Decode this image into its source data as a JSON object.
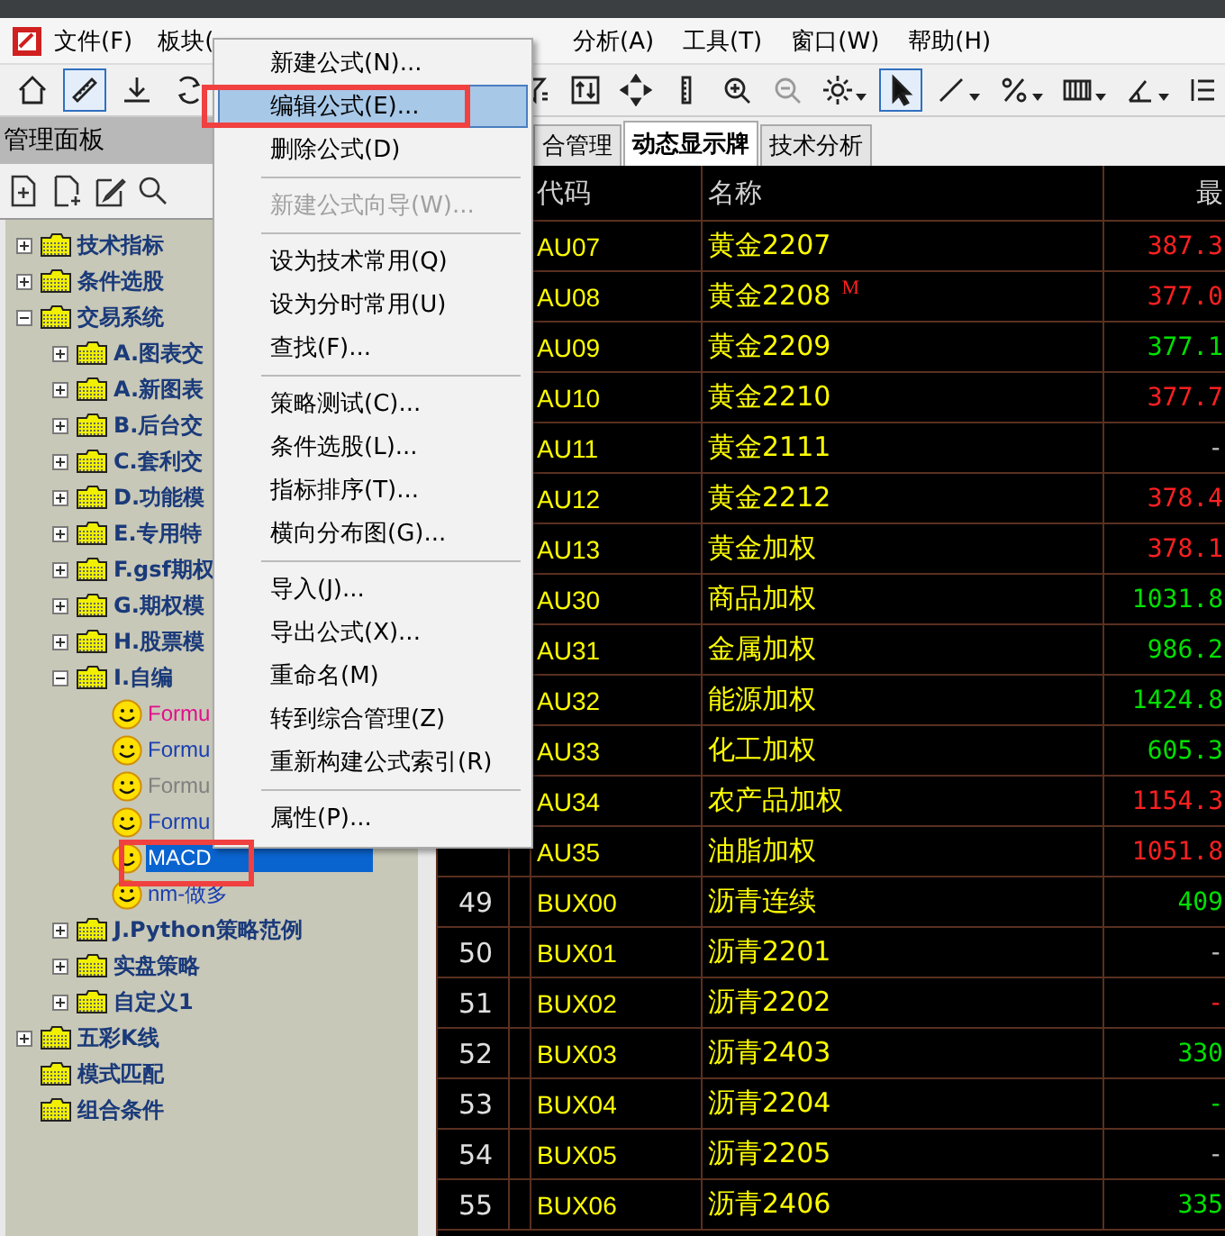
{
  "menubar": {
    "left": [
      "文件(F)",
      "板块("
    ],
    "right": [
      "分析(A)",
      "工具(T)",
      "窗口(W)",
      "帮助(H)"
    ]
  },
  "toolbar": {
    "left": [
      {
        "selected": false
      },
      {
        "selected": true
      },
      {
        "selected": false
      },
      {
        "selected": false
      }
    ],
    "right": [
      {
        "selected": false
      },
      {
        "selected": false
      },
      {
        "selected": false
      },
      {
        "selected": false
      },
      {
        "selected": false
      },
      {
        "selected": false,
        "disabled": true
      },
      {
        "selected": false
      },
      {
        "selected": true
      },
      {
        "selected": false
      },
      {
        "selected": false
      },
      {
        "selected": false
      },
      {
        "selected": false
      },
      {
        "selected": false
      }
    ]
  },
  "panel": {
    "title": "管理面板"
  },
  "tree": [
    {
      "label": "技术指标",
      "kind": "folder",
      "expanded": false
    },
    {
      "label": "条件选股",
      "kind": "folder",
      "expanded": false
    },
    {
      "label": "交易系统",
      "kind": "folder",
      "expanded": true,
      "children": [
        {
          "label": "A.图表交",
          "kind": "folder",
          "expanded": false
        },
        {
          "label": "A.新图表",
          "kind": "folder",
          "expanded": false
        },
        {
          "label": "B.后台交",
          "kind": "folder",
          "expanded": false
        },
        {
          "label": "C.套利交",
          "kind": "folder",
          "expanded": false
        },
        {
          "label": "D.功能模",
          "kind": "folder",
          "expanded": false
        },
        {
          "label": "E.专用特",
          "kind": "folder",
          "expanded": false
        },
        {
          "label": "F.gsf期权",
          "kind": "folder",
          "expanded": false
        },
        {
          "label": "G.期权模",
          "kind": "folder",
          "expanded": false
        },
        {
          "label": "H.股票模",
          "kind": "folder",
          "expanded": false
        },
        {
          "label": "I.自编",
          "kind": "folder",
          "expanded": true,
          "children": [
            {
              "label": "Formu",
              "kind": "formula",
              "color": "#e0108c",
              "selected": false
            },
            {
              "label": "Formu",
              "kind": "formula",
              "color": "#1a3fb0",
              "selected": false
            },
            {
              "label": "Formu",
              "kind": "formula",
              "color": "#808080",
              "selected": false
            },
            {
              "label": "Formu",
              "kind": "formula",
              "color": "#1a3fb0",
              "selected": false
            },
            {
              "label": "MACD",
              "kind": "formula",
              "selected": true
            },
            {
              "label": "nm-做多",
              "kind": "formula",
              "color": "#1a3fb0",
              "selected": false
            }
          ]
        },
        {
          "label": "J.Python策略范例",
          "kind": "folder",
          "expanded": false
        },
        {
          "label": "实盘策略",
          "kind": "folder",
          "expanded": false
        },
        {
          "label": "自定义1",
          "kind": "folder",
          "expanded": false
        }
      ]
    },
    {
      "label": "五彩K线",
      "kind": "folder",
      "expanded": false
    },
    {
      "label": "模式匹配",
      "kind": "folder"
    },
    {
      "label": "组合条件",
      "kind": "folder"
    }
  ],
  "tabs": [
    {
      "label": "合管理",
      "selected": false
    },
    {
      "label": "动态显示牌",
      "selected": true
    },
    {
      "label": "技术分析",
      "selected": false
    }
  ],
  "table": {
    "columns": [
      "代码",
      "名称",
      "最"
    ],
    "rows": [
      {
        "code": "AU07",
        "name": "黄金2207",
        "price": "387.3",
        "color": "#ff2020"
      },
      {
        "code": "AU08",
        "name": "黄金2208",
        "flag": "M",
        "price": "377.0",
        "color": "#ff2020"
      },
      {
        "code": "AU09",
        "name": "黄金2209",
        "price": "377.1",
        "color": "#00e000"
      },
      {
        "code": "AU10",
        "name": "黄金2210",
        "price": "377.7",
        "color": "#ff2020"
      },
      {
        "code": "AU11",
        "name": "黄金2111",
        "price": "-",
        "color": "#c0c0c0"
      },
      {
        "code": "AU12",
        "name": "黄金2212",
        "price": "378.4",
        "color": "#ff2020"
      },
      {
        "code": "AU13",
        "name": "黄金加权",
        "price": "378.1",
        "color": "#ff2020"
      },
      {
        "code": "AU30",
        "name": "商品加权",
        "price": "1031.8",
        "color": "#00e000"
      },
      {
        "code": "AU31",
        "name": "金属加权",
        "price": "986.2",
        "color": "#00e000"
      },
      {
        "code": "AU32",
        "name": "能源加权",
        "price": "1424.8",
        "color": "#00e000"
      },
      {
        "code": "AU33",
        "name": "化工加权",
        "price": "605.3",
        "color": "#00e000"
      },
      {
        "code": "AU34",
        "name": "农产品加权",
        "price": "1154.3",
        "color": "#ff2020"
      },
      {
        "code": "AU35",
        "name": "油脂加权",
        "price": "1051.8",
        "color": "#ff2020"
      },
      {
        "num": "49",
        "code": "BUX00",
        "name": "沥青连续",
        "price": "409",
        "color": "#00e000"
      },
      {
        "num": "50",
        "code": "BUX01",
        "name": "沥青2201",
        "price": "-",
        "color": "#c0c0c0"
      },
      {
        "num": "51",
        "code": "BUX02",
        "name": "沥青2202",
        "price": "-",
        "color": "#ff2020"
      },
      {
        "num": "52",
        "code": "BUX03",
        "name": "沥青2403",
        "price": "330",
        "color": "#00e000"
      },
      {
        "num": "53",
        "code": "BUX04",
        "name": "沥青2204",
        "price": "-",
        "color": "#00e000"
      },
      {
        "num": "54",
        "code": "BUX05",
        "name": "沥青2205",
        "price": "-",
        "color": "#c0c0c0"
      },
      {
        "num": "55",
        "code": "BUX06",
        "name": "沥青2406",
        "price": "335",
        "color": "#00e000"
      }
    ]
  },
  "context_menu": [
    {
      "kind": "item",
      "label": "新建公式(N)...",
      "selected": false,
      "disabled": false
    },
    {
      "kind": "item",
      "label": "编辑公式(E)...",
      "selected": true,
      "disabled": false
    },
    {
      "kind": "item",
      "label": "删除公式(D)",
      "selected": false,
      "disabled": false
    },
    {
      "kind": "separator"
    },
    {
      "kind": "item",
      "label": "新建公式向导(W)...",
      "selected": false,
      "disabled": true
    },
    {
      "kind": "separator"
    },
    {
      "kind": "item",
      "label": "设为技术常用(Q)",
      "selected": false,
      "disabled": false
    },
    {
      "kind": "item",
      "label": "设为分时常用(U)",
      "selected": false,
      "disabled": false
    },
    {
      "kind": "item",
      "label": "查找(F)...",
      "selected": false,
      "disabled": false
    },
    {
      "kind": "separator"
    },
    {
      "kind": "item",
      "label": "策略测试(C)...",
      "selected": false,
      "disabled": false
    },
    {
      "kind": "item",
      "label": "条件选股(L)...",
      "selected": false,
      "disabled": false
    },
    {
      "kind": "item",
      "label": "指标排序(T)...",
      "selected": false,
      "disabled": false
    },
    {
      "kind": "item",
      "label": "横向分布图(G)...",
      "selected": false,
      "disabled": false
    },
    {
      "kind": "separator"
    },
    {
      "kind": "item",
      "label": "导入(J)...",
      "selected": false,
      "disabled": false
    },
    {
      "kind": "item",
      "label": "导出公式(X)...",
      "selected": false,
      "disabled": false
    },
    {
      "kind": "item",
      "label": "重命名(M)",
      "selected": false,
      "disabled": false
    },
    {
      "kind": "item",
      "label": "转到综合管理(Z)",
      "selected": false,
      "disabled": false
    },
    {
      "kind": "item",
      "label": "重新构建公式索引(R)",
      "selected": false,
      "disabled": false
    },
    {
      "kind": "separator"
    },
    {
      "kind": "item",
      "label": "属性(P)...",
      "selected": false,
      "disabled": false
    }
  ]
}
